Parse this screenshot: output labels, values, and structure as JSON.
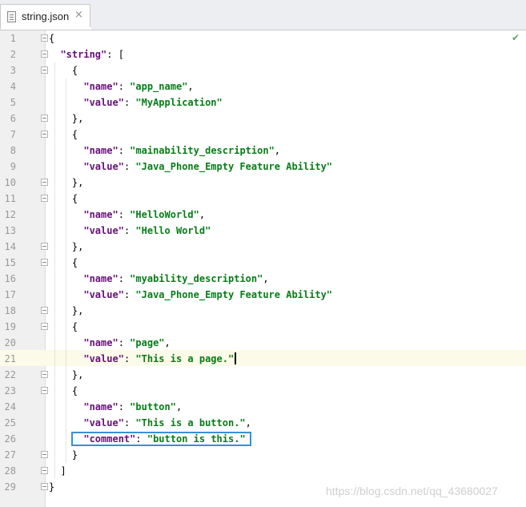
{
  "tab": {
    "title": "string.json",
    "close_glyph": "×"
  },
  "status": {
    "check": "✔"
  },
  "watermark": "https://blog.csdn.net/qq_43680027",
  "code_lines": [
    {
      "n": "1",
      "fold": true,
      "tokens": [
        [
          "p",
          "{"
        ]
      ]
    },
    {
      "n": "2",
      "fold": true,
      "tokens": [
        [
          "p",
          "  "
        ],
        [
          "k",
          "\"string\""
        ],
        [
          "p",
          ": ["
        ]
      ]
    },
    {
      "n": "3",
      "fold": true,
      "tokens": [
        [
          "p",
          "    {"
        ]
      ]
    },
    {
      "n": "4",
      "fold": false,
      "tokens": [
        [
          "p",
          "      "
        ],
        [
          "k",
          "\"name\""
        ],
        [
          "p",
          ": "
        ],
        [
          "s",
          "\"app_name\""
        ],
        [
          "p",
          ","
        ]
      ]
    },
    {
      "n": "5",
      "fold": false,
      "tokens": [
        [
          "p",
          "      "
        ],
        [
          "k",
          "\"value\""
        ],
        [
          "p",
          ": "
        ],
        [
          "s",
          "\"MyApplication\""
        ]
      ]
    },
    {
      "n": "6",
      "fold": true,
      "tokens": [
        [
          "p",
          "    },"
        ]
      ]
    },
    {
      "n": "7",
      "fold": true,
      "tokens": [
        [
          "p",
          "    {"
        ]
      ]
    },
    {
      "n": "8",
      "fold": false,
      "tokens": [
        [
          "p",
          "      "
        ],
        [
          "k",
          "\"name\""
        ],
        [
          "p",
          ": "
        ],
        [
          "s",
          "\"mainability_description\""
        ],
        [
          "p",
          ","
        ]
      ]
    },
    {
      "n": "9",
      "fold": false,
      "tokens": [
        [
          "p",
          "      "
        ],
        [
          "k",
          "\"value\""
        ],
        [
          "p",
          ": "
        ],
        [
          "s",
          "\"Java_Phone_Empty Feature Ability\""
        ]
      ]
    },
    {
      "n": "10",
      "fold": true,
      "tokens": [
        [
          "p",
          "    },"
        ]
      ]
    },
    {
      "n": "11",
      "fold": true,
      "tokens": [
        [
          "p",
          "    {"
        ]
      ]
    },
    {
      "n": "12",
      "fold": false,
      "tokens": [
        [
          "p",
          "      "
        ],
        [
          "k",
          "\"name\""
        ],
        [
          "p",
          ": "
        ],
        [
          "s",
          "\"HelloWorld\""
        ],
        [
          "p",
          ","
        ]
      ]
    },
    {
      "n": "13",
      "fold": false,
      "tokens": [
        [
          "p",
          "      "
        ],
        [
          "k",
          "\"value\""
        ],
        [
          "p",
          ": "
        ],
        [
          "s",
          "\"Hello World\""
        ]
      ]
    },
    {
      "n": "14",
      "fold": true,
      "tokens": [
        [
          "p",
          "    },"
        ]
      ]
    },
    {
      "n": "15",
      "fold": true,
      "tokens": [
        [
          "p",
          "    {"
        ]
      ]
    },
    {
      "n": "16",
      "fold": false,
      "tokens": [
        [
          "p",
          "      "
        ],
        [
          "k",
          "\"name\""
        ],
        [
          "p",
          ": "
        ],
        [
          "s",
          "\"myability_description\""
        ],
        [
          "p",
          ","
        ]
      ]
    },
    {
      "n": "17",
      "fold": false,
      "tokens": [
        [
          "p",
          "      "
        ],
        [
          "k",
          "\"value\""
        ],
        [
          "p",
          ": "
        ],
        [
          "s",
          "\"Java_Phone_Empty Feature Ability\""
        ]
      ]
    },
    {
      "n": "18",
      "fold": true,
      "tokens": [
        [
          "p",
          "    },"
        ]
      ]
    },
    {
      "n": "19",
      "fold": true,
      "tokens": [
        [
          "p",
          "    {"
        ]
      ]
    },
    {
      "n": "20",
      "fold": false,
      "tokens": [
        [
          "p",
          "      "
        ],
        [
          "k",
          "\"name\""
        ],
        [
          "p",
          ": "
        ],
        [
          "s",
          "\"page\""
        ],
        [
          "p",
          ","
        ]
      ]
    },
    {
      "n": "21",
      "fold": false,
      "caret": true,
      "tokens": [
        [
          "p",
          "      "
        ],
        [
          "k",
          "\"value\""
        ],
        [
          "p",
          ": "
        ],
        [
          "s",
          "\"This is a page.\""
        ]
      ]
    },
    {
      "n": "22",
      "fold": true,
      "tokens": [
        [
          "p",
          "    },"
        ]
      ]
    },
    {
      "n": "23",
      "fold": true,
      "tokens": [
        [
          "p",
          "    {"
        ]
      ]
    },
    {
      "n": "24",
      "fold": false,
      "tokens": [
        [
          "p",
          "      "
        ],
        [
          "k",
          "\"name\""
        ],
        [
          "p",
          ": "
        ],
        [
          "s",
          "\"button\""
        ],
        [
          "p",
          ","
        ]
      ]
    },
    {
      "n": "25",
      "fold": false,
      "tokens": [
        [
          "p",
          "      "
        ],
        [
          "k",
          "\"value\""
        ],
        [
          "p",
          ": "
        ],
        [
          "s",
          "\"This is a button.\""
        ],
        [
          "p",
          ","
        ]
      ]
    },
    {
      "n": "26",
      "fold": false,
      "tokens": [
        [
          "p",
          "      "
        ],
        [
          "k",
          "\"comment\""
        ],
        [
          "p",
          ": "
        ],
        [
          "s",
          "\"button is this.\""
        ]
      ]
    },
    {
      "n": "27",
      "fold": true,
      "tokens": [
        [
          "p",
          "    }"
        ]
      ]
    },
    {
      "n": "28",
      "fold": true,
      "tokens": [
        [
          "p",
          "  ]"
        ]
      ]
    },
    {
      "n": "29",
      "fold": true,
      "tokens": [
        [
          "p",
          "}"
        ]
      ]
    }
  ],
  "colors": {
    "key": "#660e7a",
    "string": "#067d17",
    "highlight_border": "#3a8fd8",
    "caret_line": "#fcfae8"
  }
}
